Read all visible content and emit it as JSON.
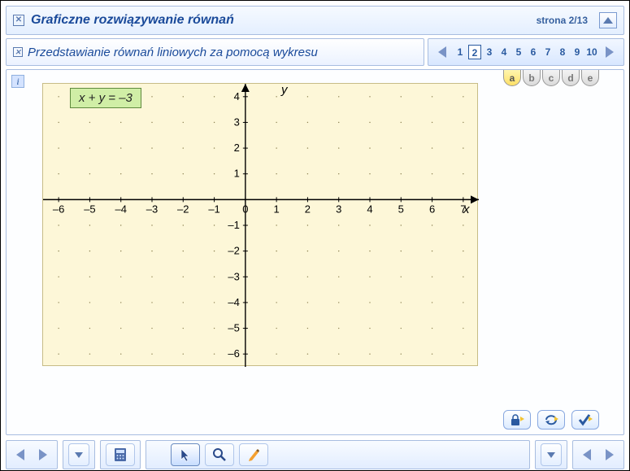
{
  "header": {
    "title": "Graficzne rozwiązywanie równań",
    "page_label": "strona",
    "page_current": 2,
    "page_total": 13
  },
  "subheader": {
    "title": "Przedstawianie równań liniowych za pomocą wykresu",
    "pages": [
      "1",
      "2",
      "3",
      "4",
      "5",
      "6",
      "7",
      "8",
      "9",
      "10"
    ],
    "activePage": "2"
  },
  "tabs": {
    "items": [
      "a",
      "b",
      "c",
      "d",
      "e"
    ],
    "active": "a"
  },
  "equation": "x + y = –3",
  "chart_data": {
    "type": "line",
    "title": "",
    "xlabel": "x",
    "ylabel": "y",
    "xlim": [
      -6.5,
      7.5
    ],
    "ylim": [
      -6.5,
      4.5
    ],
    "xticks": [
      -6,
      -5,
      -4,
      -3,
      -2,
      -1,
      0,
      1,
      2,
      3,
      4,
      5,
      6,
      7
    ],
    "yticks": [
      -6,
      -5,
      -4,
      -3,
      -2,
      -1,
      1,
      2,
      3,
      4
    ],
    "grid": "dotted",
    "series": []
  },
  "tools": {
    "t1": "lock-icon",
    "t2": "refresh-icon",
    "t3": "check-icon"
  },
  "bottom": {
    "calc": "calculator-icon",
    "pointer": "pointer-icon",
    "zoom": "magnifier-icon",
    "pen": "crayon-icon"
  }
}
